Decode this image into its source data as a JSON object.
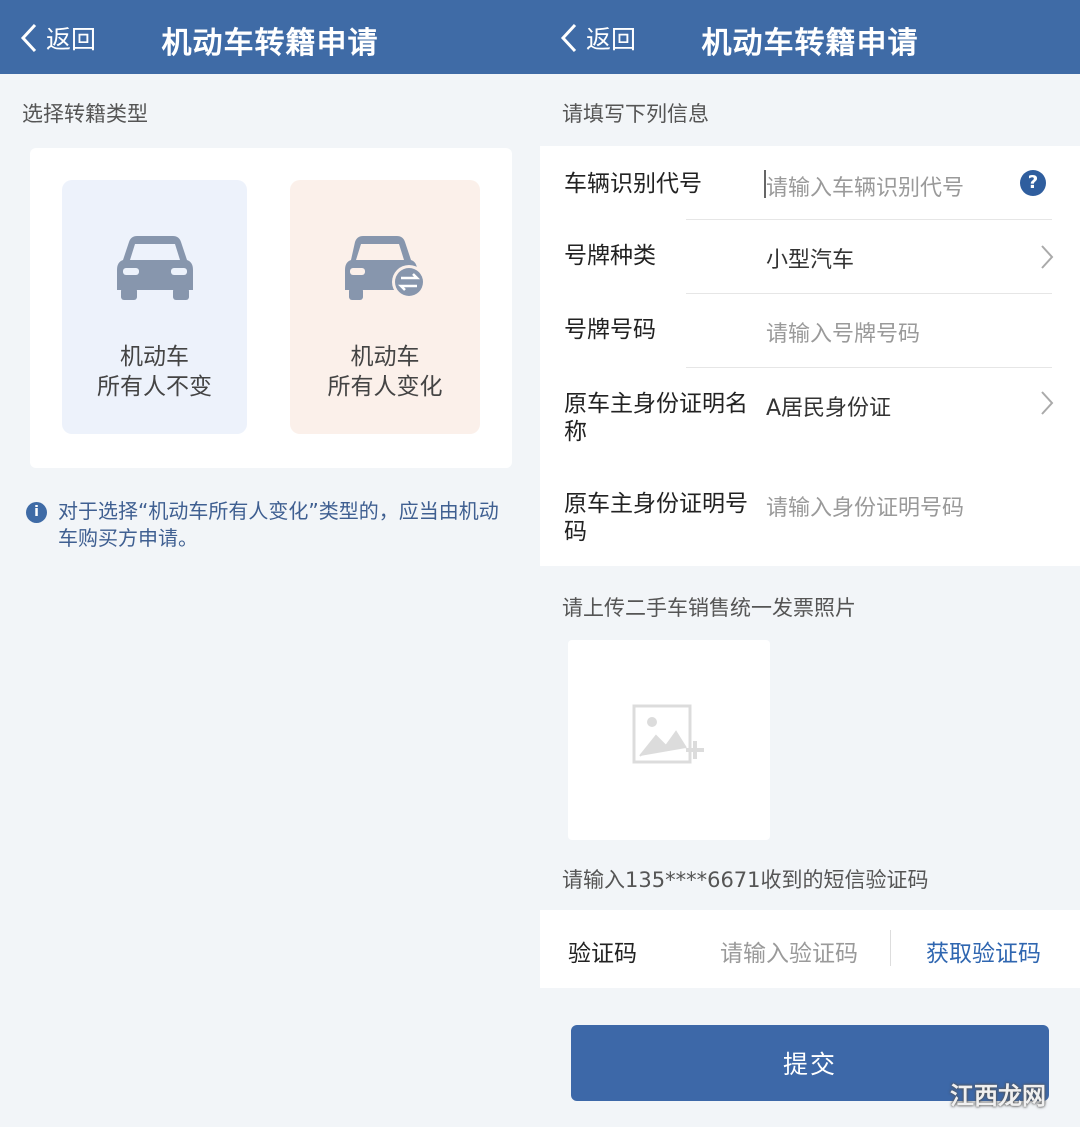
{
  "left": {
    "header": {
      "back_label": "返回",
      "title": "机动车转籍申请"
    },
    "section_label": "选择转籍类型",
    "options": [
      {
        "line1": "机动车",
        "line2": "所有人不变",
        "icon": "car-icon"
      },
      {
        "line1": "机动车",
        "line2": "所有人变化",
        "icon": "car-transfer-icon"
      }
    ],
    "note": "对于选择“机动车所有人变化”类型的，应当由机动车购买方申请。"
  },
  "right": {
    "header": {
      "back_label": "返回",
      "title": "机动车转籍申请"
    },
    "section_label": "请填写下列信息",
    "fields": [
      {
        "label": "车辆识别代号",
        "value": "请输入车辆识别代号",
        "is_placeholder": true
      },
      {
        "label": "号牌种类",
        "value": "小型汽车",
        "is_placeholder": false
      },
      {
        "label": "号牌号码",
        "value": "请输入号牌号码",
        "is_placeholder": true
      },
      {
        "label": "原车主身份证明名称",
        "value": "A居民身份证",
        "is_placeholder": false
      },
      {
        "label": "原车主身份证明号码",
        "value": "请输入身份证明号码",
        "is_placeholder": true
      }
    ],
    "upload_label": "请上传二手车销售统一发票照片",
    "sms_prompt": "请输入135****6671收到的短信验证码",
    "code": {
      "label": "验证码",
      "placeholder": "请输入验证码",
      "get_code": "获取验证码"
    },
    "submit_label": "提交"
  },
  "watermark": "江西龙网",
  "colors": {
    "header": "#3f6ba6",
    "link": "#2f66b0",
    "background": "#f2f5f8"
  }
}
